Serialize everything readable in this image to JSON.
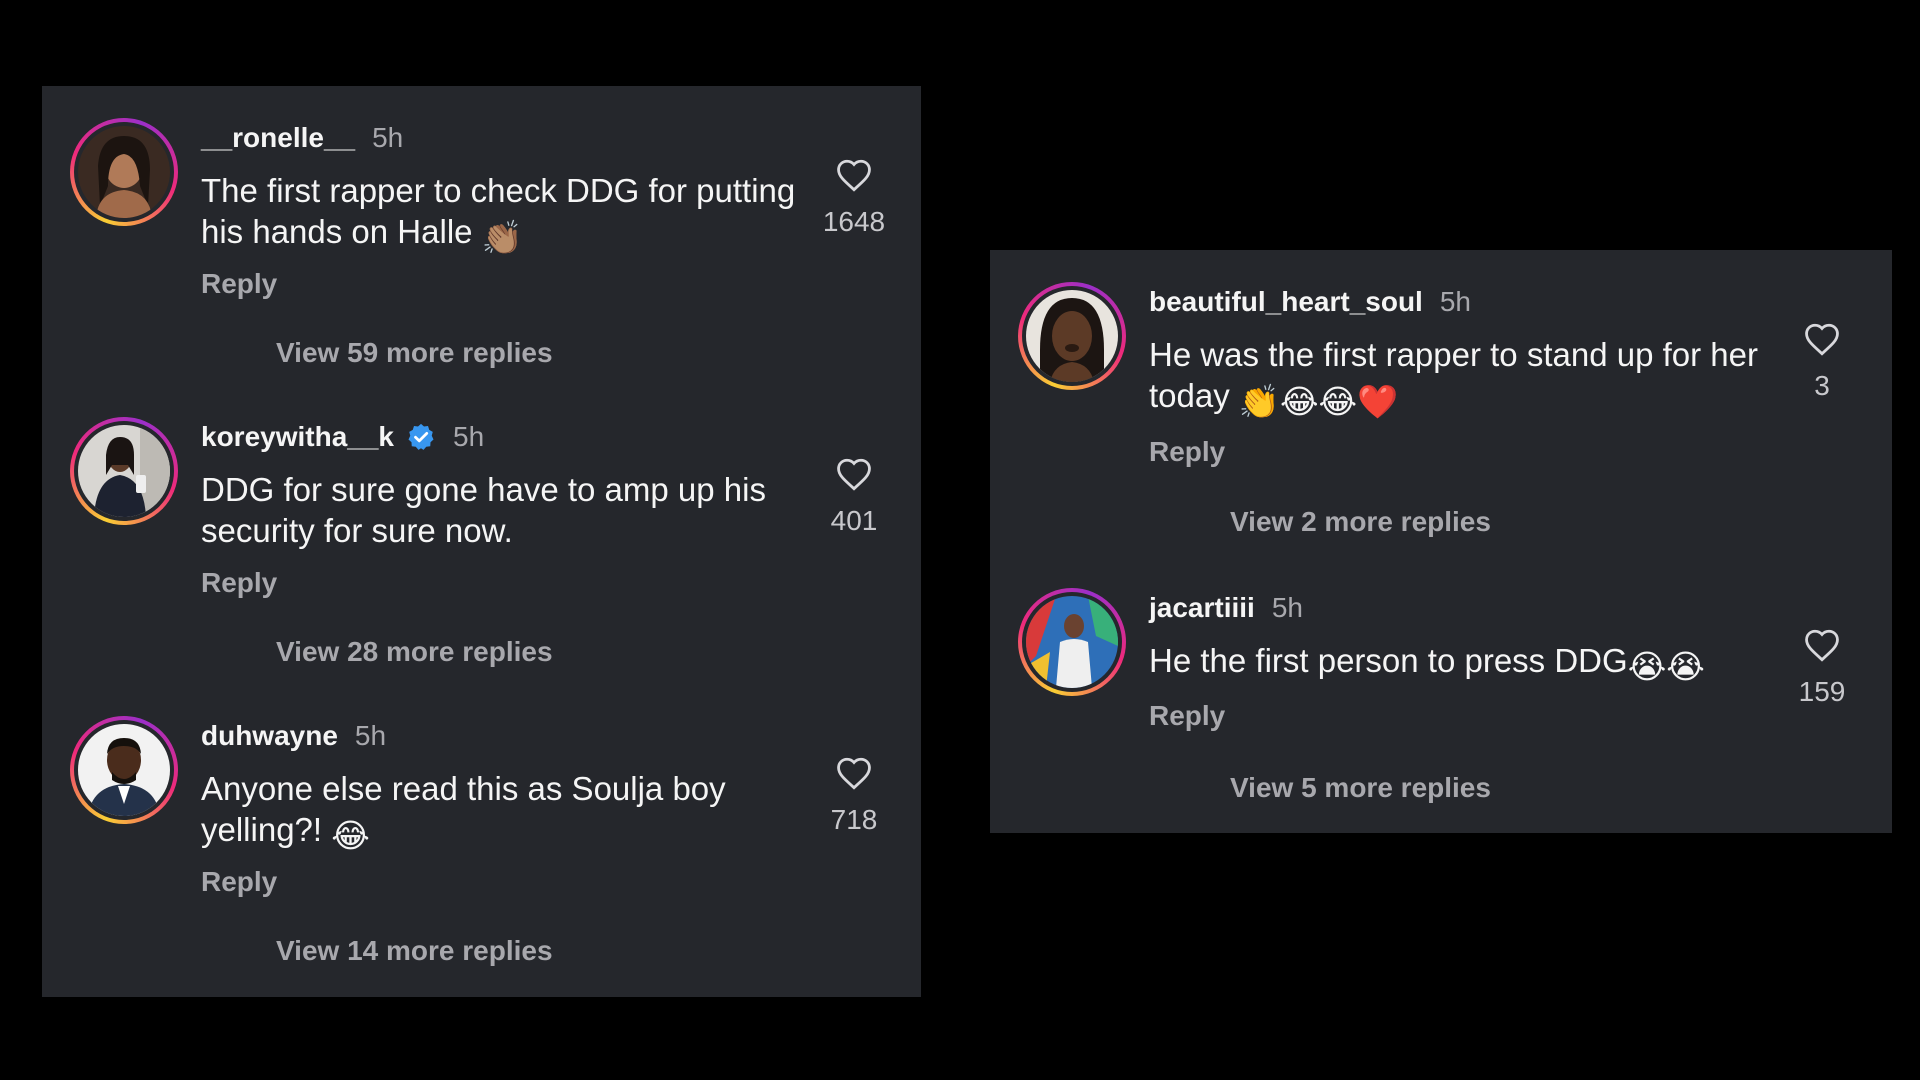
{
  "left_panel": {
    "comments": [
      {
        "username": "__ronelle__",
        "time": "5h",
        "text": "The first rapper to check DDG for putting his hands on Halle",
        "emoji": "👏🏽",
        "likes": "1648",
        "reply_label": "Reply",
        "view_more": "View 59 more replies",
        "verified": false
      },
      {
        "username": "koreywitha__k",
        "time": "5h",
        "text": "DDG for sure gone have to amp up his security for sure now.",
        "emoji": "",
        "likes": "401",
        "reply_label": "Reply",
        "view_more": "View 28 more replies",
        "verified": true
      },
      {
        "username": "duhwayne",
        "time": "5h",
        "text": "Anyone else read this as Soulja boy yelling?!",
        "emoji": "😂",
        "likes": "718",
        "reply_label": "Reply",
        "view_more": "View 14 more replies",
        "verified": false
      }
    ]
  },
  "right_panel": {
    "comments": [
      {
        "username": "beautiful_heart_soul",
        "time": "5h",
        "text": "He was the first rapper to stand up for her today",
        "emoji": "👏😂😂❤️",
        "likes": "3",
        "reply_label": "Reply",
        "view_more": "View 2 more replies",
        "verified": false
      },
      {
        "username": "jacartiiii",
        "time": "5h",
        "text": "He the first person to press DDG",
        "emoji": "😭😭",
        "likes": "159",
        "reply_label": "Reply",
        "view_more": "View 5 more replies",
        "verified": false
      }
    ]
  },
  "icons": {
    "like": "heart-outline-icon",
    "verified": "verified-badge-icon"
  },
  "colors": {
    "background": "#000000",
    "panel": "#25272c",
    "primary_text": "#f5f5f5",
    "secondary_text": "#a8a8ad",
    "verified_blue": "#3897f0"
  }
}
